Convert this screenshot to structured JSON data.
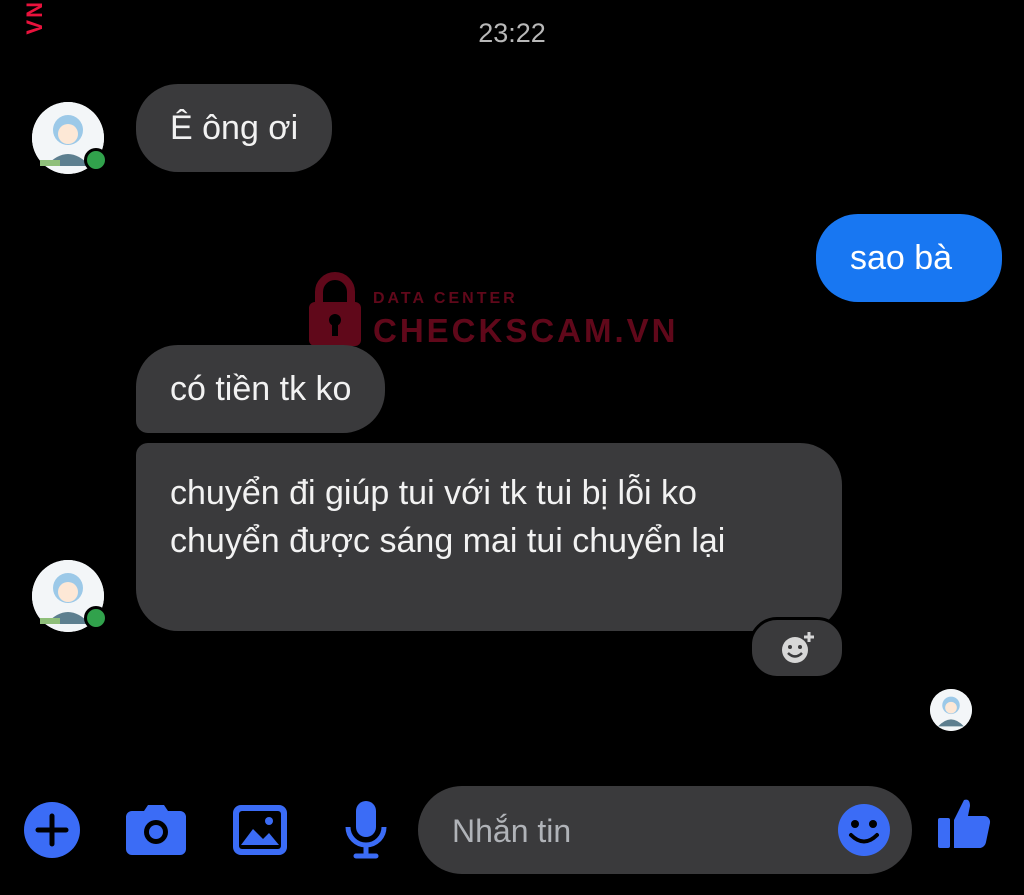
{
  "edge_mark": "VN",
  "timestamp": "23:22",
  "watermark": {
    "small": "DATA CENTER",
    "big": "CHECKSCAM.VN"
  },
  "messages": [
    {
      "sender": "contact",
      "text": "Ê ông ơi"
    },
    {
      "sender": "me",
      "text": "sao bà"
    },
    {
      "sender": "contact",
      "text": "có tiền tk ko"
    },
    {
      "sender": "contact",
      "text": "chuyển đi giúp tui với tk tui bị lỗi ko chuyển được sáng mai tui chuyển lại"
    }
  ],
  "composer": {
    "placeholder": "Nhắn tin",
    "value": ""
  },
  "icons": {
    "add": "plus-circle-icon",
    "camera": "camera-icon",
    "gallery": "image-icon",
    "voice": "microphone-icon",
    "emoji": "smiley-icon",
    "like": "thumbs-up-icon",
    "react": "add-reaction-icon"
  },
  "colors": {
    "background": "#000000",
    "received_bubble": "#3a3a3c",
    "sent_bubble": "#1877f2",
    "accent": "#3b6cf6",
    "online": "#31a24c",
    "watermark": "#b01030"
  }
}
